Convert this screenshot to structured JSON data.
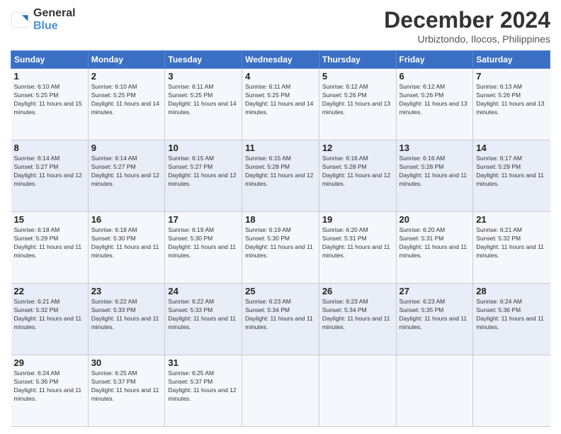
{
  "logo": {
    "line1": "General",
    "line2": "Blue"
  },
  "title": "December 2024",
  "subtitle": "Urbiztondo, Ilocos, Philippines",
  "weekdays": [
    "Sunday",
    "Monday",
    "Tuesday",
    "Wednesday",
    "Thursday",
    "Friday",
    "Saturday"
  ],
  "weeks": [
    [
      {
        "day": "1",
        "sunrise": "6:10 AM",
        "sunset": "5:25 PM",
        "daylight": "11 hours and 15 minutes."
      },
      {
        "day": "2",
        "sunrise": "6:10 AM",
        "sunset": "5:25 PM",
        "daylight": "11 hours and 14 minutes."
      },
      {
        "day": "3",
        "sunrise": "6:11 AM",
        "sunset": "5:25 PM",
        "daylight": "11 hours and 14 minutes."
      },
      {
        "day": "4",
        "sunrise": "6:11 AM",
        "sunset": "5:25 PM",
        "daylight": "11 hours and 14 minutes."
      },
      {
        "day": "5",
        "sunrise": "6:12 AM",
        "sunset": "5:26 PM",
        "daylight": "11 hours and 13 minutes."
      },
      {
        "day": "6",
        "sunrise": "6:12 AM",
        "sunset": "5:26 PM",
        "daylight": "11 hours and 13 minutes."
      },
      {
        "day": "7",
        "sunrise": "6:13 AM",
        "sunset": "5:26 PM",
        "daylight": "11 hours and 13 minutes."
      }
    ],
    [
      {
        "day": "8",
        "sunrise": "6:14 AM",
        "sunset": "5:27 PM",
        "daylight": "11 hours and 12 minutes."
      },
      {
        "day": "9",
        "sunrise": "6:14 AM",
        "sunset": "5:27 PM",
        "daylight": "11 hours and 12 minutes."
      },
      {
        "day": "10",
        "sunrise": "6:15 AM",
        "sunset": "5:27 PM",
        "daylight": "11 hours and 12 minutes."
      },
      {
        "day": "11",
        "sunrise": "6:15 AM",
        "sunset": "5:28 PM",
        "daylight": "11 hours and 12 minutes."
      },
      {
        "day": "12",
        "sunrise": "6:16 AM",
        "sunset": "5:28 PM",
        "daylight": "11 hours and 12 minutes."
      },
      {
        "day": "13",
        "sunrise": "6:16 AM",
        "sunset": "5:28 PM",
        "daylight": "11 hours and 11 minutes."
      },
      {
        "day": "14",
        "sunrise": "6:17 AM",
        "sunset": "5:29 PM",
        "daylight": "11 hours and 11 minutes."
      }
    ],
    [
      {
        "day": "15",
        "sunrise": "6:18 AM",
        "sunset": "5:29 PM",
        "daylight": "11 hours and 11 minutes."
      },
      {
        "day": "16",
        "sunrise": "6:18 AM",
        "sunset": "5:30 PM",
        "daylight": "11 hours and 11 minutes."
      },
      {
        "day": "17",
        "sunrise": "6:19 AM",
        "sunset": "5:30 PM",
        "daylight": "11 hours and 11 minutes."
      },
      {
        "day": "18",
        "sunrise": "6:19 AM",
        "sunset": "5:30 PM",
        "daylight": "11 hours and 11 minutes."
      },
      {
        "day": "19",
        "sunrise": "6:20 AM",
        "sunset": "5:31 PM",
        "daylight": "11 hours and 11 minutes."
      },
      {
        "day": "20",
        "sunrise": "6:20 AM",
        "sunset": "5:31 PM",
        "daylight": "11 hours and 11 minutes."
      },
      {
        "day": "21",
        "sunrise": "6:21 AM",
        "sunset": "5:32 PM",
        "daylight": "11 hours and 11 minutes."
      }
    ],
    [
      {
        "day": "22",
        "sunrise": "6:21 AM",
        "sunset": "5:32 PM",
        "daylight": "11 hours and 11 minutes."
      },
      {
        "day": "23",
        "sunrise": "6:22 AM",
        "sunset": "5:33 PM",
        "daylight": "11 hours and 11 minutes."
      },
      {
        "day": "24",
        "sunrise": "6:22 AM",
        "sunset": "5:33 PM",
        "daylight": "11 hours and 11 minutes."
      },
      {
        "day": "25",
        "sunrise": "6:23 AM",
        "sunset": "5:34 PM",
        "daylight": "11 hours and 11 minutes."
      },
      {
        "day": "26",
        "sunrise": "6:23 AM",
        "sunset": "5:34 PM",
        "daylight": "11 hours and 11 minutes."
      },
      {
        "day": "27",
        "sunrise": "6:23 AM",
        "sunset": "5:35 PM",
        "daylight": "11 hours and 11 minutes."
      },
      {
        "day": "28",
        "sunrise": "6:24 AM",
        "sunset": "5:36 PM",
        "daylight": "11 hours and 11 minutes."
      }
    ],
    [
      {
        "day": "29",
        "sunrise": "6:24 AM",
        "sunset": "5:36 PM",
        "daylight": "11 hours and 11 minutes."
      },
      {
        "day": "30",
        "sunrise": "6:25 AM",
        "sunset": "5:37 PM",
        "daylight": "11 hours and 11 minutes."
      },
      {
        "day": "31",
        "sunrise": "6:25 AM",
        "sunset": "5:37 PM",
        "daylight": "11 hours and 12 minutes."
      },
      null,
      null,
      null,
      null
    ]
  ]
}
